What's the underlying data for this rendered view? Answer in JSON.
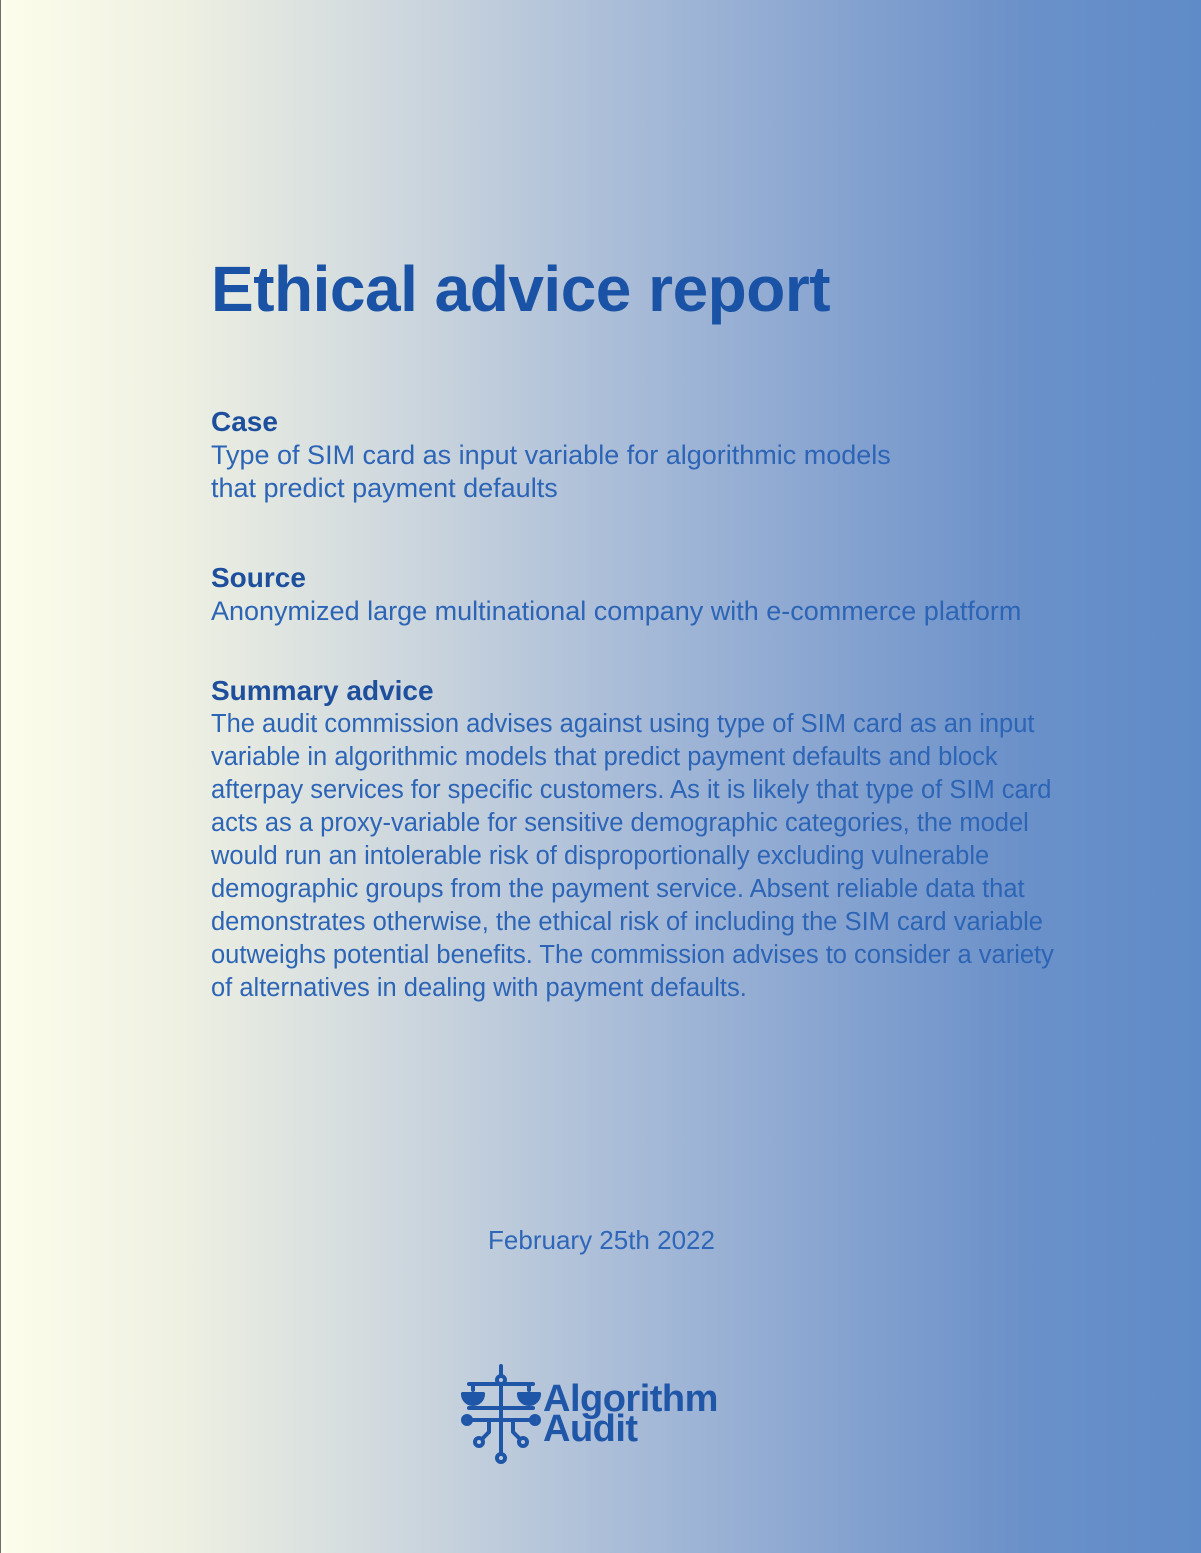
{
  "document": {
    "title": "Ethical advice report",
    "case": {
      "heading": "Case",
      "text": "Type of SIM card as input variable for algorithmic models that predict payment defaults"
    },
    "source": {
      "heading": "Source",
      "text": "Anonymized large multinational company with e-commerce platform"
    },
    "summary": {
      "heading": "Summary advice",
      "text": "The audit commission advises against using type of SIM card as an input variable in algorithmic models that predict payment defaults and block afterpay services for specific customers. As it is likely that type of SIM card acts as a proxy-variable for sensitive demographic categories, the model would run an intolerable risk of disproportionally excluding vulnerable demographic groups from the payment service. Absent reliable data that demonstrates otherwise, the ethical risk of including the SIM card variable outweighs potential benefits. The commission advises to consider a variety of alternatives in dealing with payment defaults."
    },
    "date": "February 25th 2022"
  },
  "logo": {
    "line1": "Algorithm",
    "line2": "Audit",
    "icon": "scales-circuit-icon"
  },
  "colors": {
    "text_primary": "#1f56a8",
    "gradient_left": "#fdfdeb",
    "gradient_right": "#5f8bc8"
  }
}
